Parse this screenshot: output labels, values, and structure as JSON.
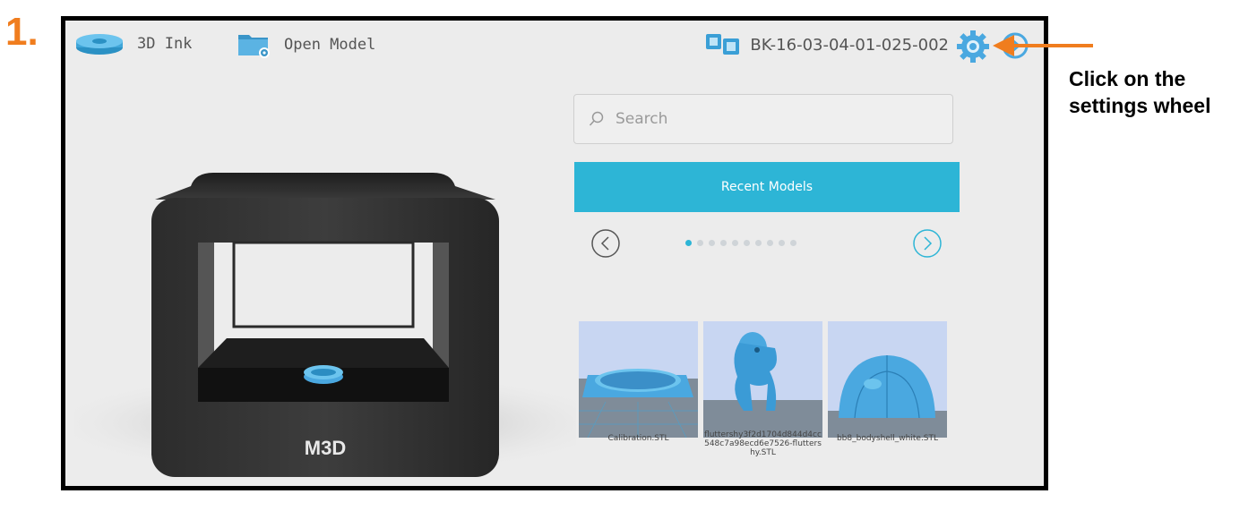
{
  "step": {
    "number": "1."
  },
  "topbar": {
    "ink_label": "3D Ink",
    "open_model_label": "Open Model",
    "serial": "BK-16-03-04-01-025-002"
  },
  "printer": {
    "logo": "M3D"
  },
  "search": {
    "placeholder": "Search"
  },
  "recent": {
    "label": "Recent Models",
    "page_count": 10,
    "current_page": 1,
    "models": [
      {
        "name": "Calibration.STL"
      },
      {
        "name": "fluttershy3f2d1704d844d4cc548c7a98ecd6e7526-fluttershy.STL"
      },
      {
        "name": "bb8_bodyshell_white.STL"
      }
    ]
  },
  "annotation": {
    "line1": "Click on the",
    "line2": "settings wheel"
  },
  "colors": {
    "accent": "#2db5d6",
    "annotation": "#f07d1e",
    "model_blue": "#4aa8e0"
  },
  "icons": [
    "spool-icon",
    "folder-icon",
    "device-icon",
    "gear-icon",
    "power-icon",
    "search-icon",
    "chevron-left-icon",
    "chevron-right-icon"
  ]
}
